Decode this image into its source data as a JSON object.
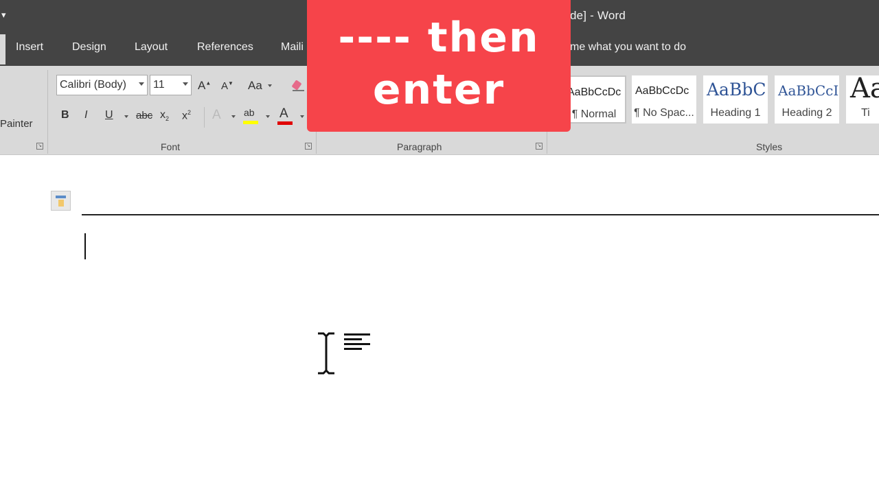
{
  "titlebar": {
    "qat_more": "▾",
    "title": "de]  -  Word"
  },
  "tabs": [
    {
      "label": "Insert"
    },
    {
      "label": "Design"
    },
    {
      "label": "Layout"
    },
    {
      "label": "References"
    },
    {
      "label": "Maili"
    }
  ],
  "tell_me": "me what you want to do",
  "ribbon": {
    "clipboard": {
      "format_painter_label": "Painter"
    },
    "font": {
      "group_label": "Font",
      "font_name": "Calibri (Body)",
      "font_size": "11",
      "grow_label": "A",
      "shrink_label": "A",
      "change_case_label": "Aa",
      "bold_label": "B",
      "italic_label": "I",
      "underline_label": "U",
      "strike_label": "abc",
      "subscript_label": "x",
      "subscript_sub": "2",
      "superscript_label": "x",
      "superscript_sup": "2",
      "text_effects_label": "A",
      "highlight_label": "ab",
      "font_color_label": "A",
      "highlight_color": "#ffff00",
      "font_color": "#e00000"
    },
    "paragraph": {
      "group_label": "Paragraph"
    },
    "styles": {
      "group_label": "Styles",
      "items": [
        {
          "sample": "AaBbCcDc",
          "name": "¶ Normal",
          "selected": true
        },
        {
          "sample": "AaBbCcDc",
          "name": "¶ No Spac..."
        },
        {
          "sample": "AaBbC",
          "name": "Heading 1"
        },
        {
          "sample": "AaBbCcI",
          "name": "Heading 2"
        },
        {
          "sample": "Aa",
          "name": "Ti"
        }
      ]
    }
  },
  "overlay": {
    "line1": "---- then",
    "line2": "enter"
  }
}
